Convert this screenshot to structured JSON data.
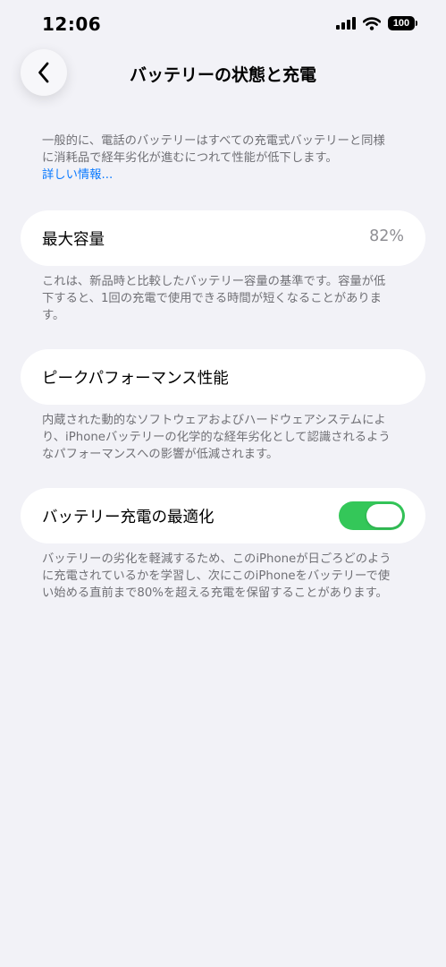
{
  "status_bar": {
    "time": "12:06",
    "battery_level": "100",
    "icons": [
      "cellular-signal-icon",
      "wifi-icon",
      "battery-icon"
    ]
  },
  "nav": {
    "title": "バッテリーの状態と充電",
    "back_icon": "chevron-left-icon"
  },
  "intro": {
    "text": "一般的に、電話のバッテリーはすべての充電式バッテリーと同様に消耗品で経年劣化が進むにつれて性能が低下します。",
    "link": "詳しい情報..."
  },
  "max_capacity": {
    "label": "最大容量",
    "value": "82%",
    "note": "これは、新品時と比較したバッテリー容量の基準です。容量が低下すると、1回の充電で使用できる時間が短くなることがあります。"
  },
  "peak_performance": {
    "label": "ピークパフォーマンス性能",
    "note": "内蔵された動的なソフトウェアおよびハードウェアシステムにより、iPhoneバッテリーの化学的な経年劣化として認識されるようなパフォーマンスへの影響が低減されます。"
  },
  "optimized_charging": {
    "label": "バッテリー充電の最適化",
    "enabled": true,
    "note": "バッテリーの劣化を軽減するため、このiPhoneが日ごろどのように充電されているかを学習し、次にこのiPhoneをバッテリーで使い始める直前まで80%を超える充電を保留することがあります。"
  },
  "colors": {
    "background": "#f2f2f7",
    "cell": "#ffffff",
    "link": "#0a7aff",
    "toggle_on": "#34c759",
    "secondary_text": "#707075"
  }
}
